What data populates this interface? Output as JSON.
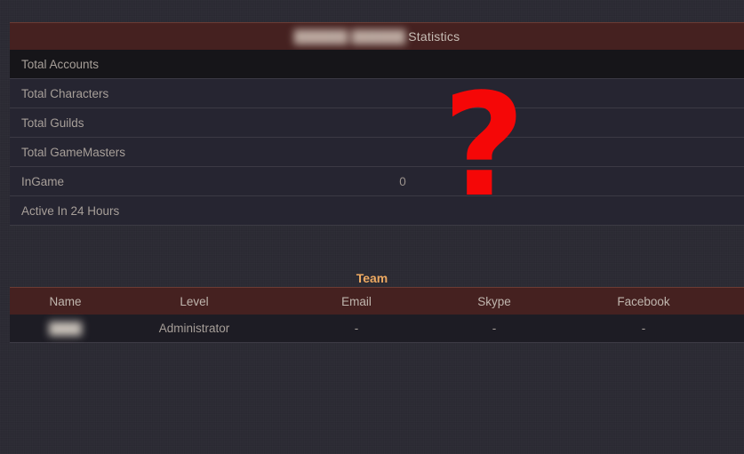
{
  "page": {
    "background_color": "#2b2933",
    "accent_bar_color": "#452120",
    "team_title_color": "#eda961",
    "overlay_marker_color": "#f50707"
  },
  "statistics": {
    "title_redacted": "██████ ██████",
    "title_suffix": "Statistics",
    "rows": [
      {
        "label": "Total Accounts",
        "value": ""
      },
      {
        "label": "Total Characters",
        "value": ""
      },
      {
        "label": "Total Guilds",
        "value": ""
      },
      {
        "label": "Total GameMasters",
        "value": ""
      },
      {
        "label": "InGame",
        "value": "0"
      },
      {
        "label": "Active In 24 Hours",
        "value": ""
      }
    ]
  },
  "overlay": {
    "marker": "?"
  },
  "team": {
    "title": "Team",
    "columns": [
      "Name",
      "Level",
      "Email",
      "Skype",
      "Facebook"
    ],
    "rows": [
      {
        "name": "████",
        "level": "Administrator",
        "email": "-",
        "skype": "-",
        "facebook": "-"
      }
    ]
  }
}
